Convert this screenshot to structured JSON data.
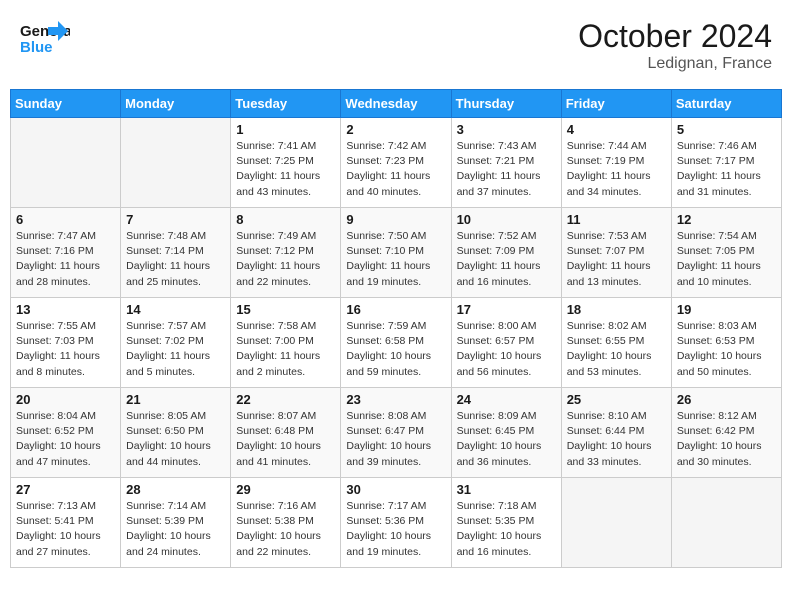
{
  "logo": {
    "line1": "General",
    "line2": "Blue"
  },
  "header": {
    "month": "October 2024",
    "location": "Ledignan, France"
  },
  "weekdays": [
    "Sunday",
    "Monday",
    "Tuesday",
    "Wednesday",
    "Thursday",
    "Friday",
    "Saturday"
  ],
  "weeks": [
    [
      {
        "day": "",
        "info": ""
      },
      {
        "day": "",
        "info": ""
      },
      {
        "day": "1",
        "info": "Sunrise: 7:41 AM\nSunset: 7:25 PM\nDaylight: 11 hours\nand 43 minutes."
      },
      {
        "day": "2",
        "info": "Sunrise: 7:42 AM\nSunset: 7:23 PM\nDaylight: 11 hours\nand 40 minutes."
      },
      {
        "day": "3",
        "info": "Sunrise: 7:43 AM\nSunset: 7:21 PM\nDaylight: 11 hours\nand 37 minutes."
      },
      {
        "day": "4",
        "info": "Sunrise: 7:44 AM\nSunset: 7:19 PM\nDaylight: 11 hours\nand 34 minutes."
      },
      {
        "day": "5",
        "info": "Sunrise: 7:46 AM\nSunset: 7:17 PM\nDaylight: 11 hours\nand 31 minutes."
      }
    ],
    [
      {
        "day": "6",
        "info": "Sunrise: 7:47 AM\nSunset: 7:16 PM\nDaylight: 11 hours\nand 28 minutes."
      },
      {
        "day": "7",
        "info": "Sunrise: 7:48 AM\nSunset: 7:14 PM\nDaylight: 11 hours\nand 25 minutes."
      },
      {
        "day": "8",
        "info": "Sunrise: 7:49 AM\nSunset: 7:12 PM\nDaylight: 11 hours\nand 22 minutes."
      },
      {
        "day": "9",
        "info": "Sunrise: 7:50 AM\nSunset: 7:10 PM\nDaylight: 11 hours\nand 19 minutes."
      },
      {
        "day": "10",
        "info": "Sunrise: 7:52 AM\nSunset: 7:09 PM\nDaylight: 11 hours\nand 16 minutes."
      },
      {
        "day": "11",
        "info": "Sunrise: 7:53 AM\nSunset: 7:07 PM\nDaylight: 11 hours\nand 13 minutes."
      },
      {
        "day": "12",
        "info": "Sunrise: 7:54 AM\nSunset: 7:05 PM\nDaylight: 11 hours\nand 10 minutes."
      }
    ],
    [
      {
        "day": "13",
        "info": "Sunrise: 7:55 AM\nSunset: 7:03 PM\nDaylight: 11 hours\nand 8 minutes."
      },
      {
        "day": "14",
        "info": "Sunrise: 7:57 AM\nSunset: 7:02 PM\nDaylight: 11 hours\nand 5 minutes."
      },
      {
        "day": "15",
        "info": "Sunrise: 7:58 AM\nSunset: 7:00 PM\nDaylight: 11 hours\nand 2 minutes."
      },
      {
        "day": "16",
        "info": "Sunrise: 7:59 AM\nSunset: 6:58 PM\nDaylight: 10 hours\nand 59 minutes."
      },
      {
        "day": "17",
        "info": "Sunrise: 8:00 AM\nSunset: 6:57 PM\nDaylight: 10 hours\nand 56 minutes."
      },
      {
        "day": "18",
        "info": "Sunrise: 8:02 AM\nSunset: 6:55 PM\nDaylight: 10 hours\nand 53 minutes."
      },
      {
        "day": "19",
        "info": "Sunrise: 8:03 AM\nSunset: 6:53 PM\nDaylight: 10 hours\nand 50 minutes."
      }
    ],
    [
      {
        "day": "20",
        "info": "Sunrise: 8:04 AM\nSunset: 6:52 PM\nDaylight: 10 hours\nand 47 minutes."
      },
      {
        "day": "21",
        "info": "Sunrise: 8:05 AM\nSunset: 6:50 PM\nDaylight: 10 hours\nand 44 minutes."
      },
      {
        "day": "22",
        "info": "Sunrise: 8:07 AM\nSunset: 6:48 PM\nDaylight: 10 hours\nand 41 minutes."
      },
      {
        "day": "23",
        "info": "Sunrise: 8:08 AM\nSunset: 6:47 PM\nDaylight: 10 hours\nand 39 minutes."
      },
      {
        "day": "24",
        "info": "Sunrise: 8:09 AM\nSunset: 6:45 PM\nDaylight: 10 hours\nand 36 minutes."
      },
      {
        "day": "25",
        "info": "Sunrise: 8:10 AM\nSunset: 6:44 PM\nDaylight: 10 hours\nand 33 minutes."
      },
      {
        "day": "26",
        "info": "Sunrise: 8:12 AM\nSunset: 6:42 PM\nDaylight: 10 hours\nand 30 minutes."
      }
    ],
    [
      {
        "day": "27",
        "info": "Sunrise: 7:13 AM\nSunset: 5:41 PM\nDaylight: 10 hours\nand 27 minutes."
      },
      {
        "day": "28",
        "info": "Sunrise: 7:14 AM\nSunset: 5:39 PM\nDaylight: 10 hours\nand 24 minutes."
      },
      {
        "day": "29",
        "info": "Sunrise: 7:16 AM\nSunset: 5:38 PM\nDaylight: 10 hours\nand 22 minutes."
      },
      {
        "day": "30",
        "info": "Sunrise: 7:17 AM\nSunset: 5:36 PM\nDaylight: 10 hours\nand 19 minutes."
      },
      {
        "day": "31",
        "info": "Sunrise: 7:18 AM\nSunset: 5:35 PM\nDaylight: 10 hours\nand 16 minutes."
      },
      {
        "day": "",
        "info": ""
      },
      {
        "day": "",
        "info": ""
      }
    ]
  ]
}
